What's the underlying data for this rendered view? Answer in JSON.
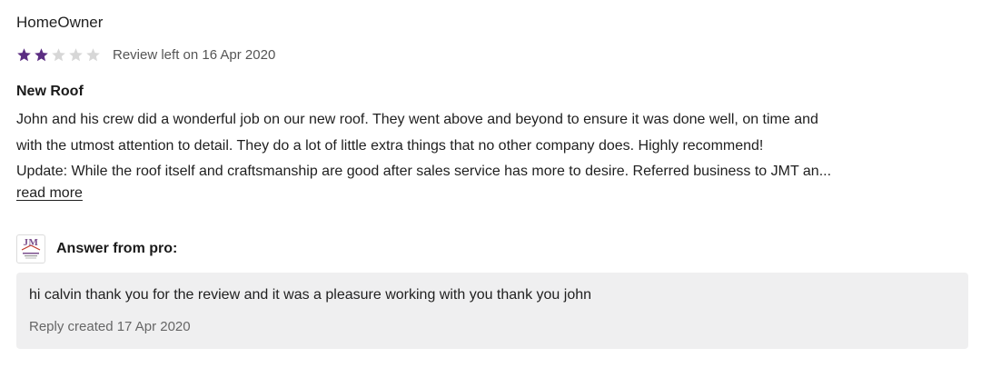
{
  "review": {
    "author": "HomeOwner",
    "rating": 2,
    "rating_max": 5,
    "star_filled_color": "#5b2d82",
    "star_empty_color": "#d7d7d7",
    "date_text": "Review left on 16 Apr 2020",
    "title": "New Roof",
    "body_lines": [
      "John and his crew did a wonderful job on our new roof. They went above and beyond to ensure it was done well, on time and",
      "with the utmost attention to detail. They do a lot of little extra things that no other company does. Highly recommend!",
      "Update:  While the roof itself and craftsmanship are good after sales service has more to desire. Referred business to JMT an..."
    ],
    "read_more_label": "read more"
  },
  "answer": {
    "logo_icon": "company-logo-icon",
    "logo_text": "JM",
    "label": "Answer from pro:",
    "reply_text": "hi calvin thank you for the review and it was a pleasure working with you thank you john",
    "reply_date_text": "Reply created 17 Apr 2020",
    "reply_bg_color": "#efeff0"
  }
}
